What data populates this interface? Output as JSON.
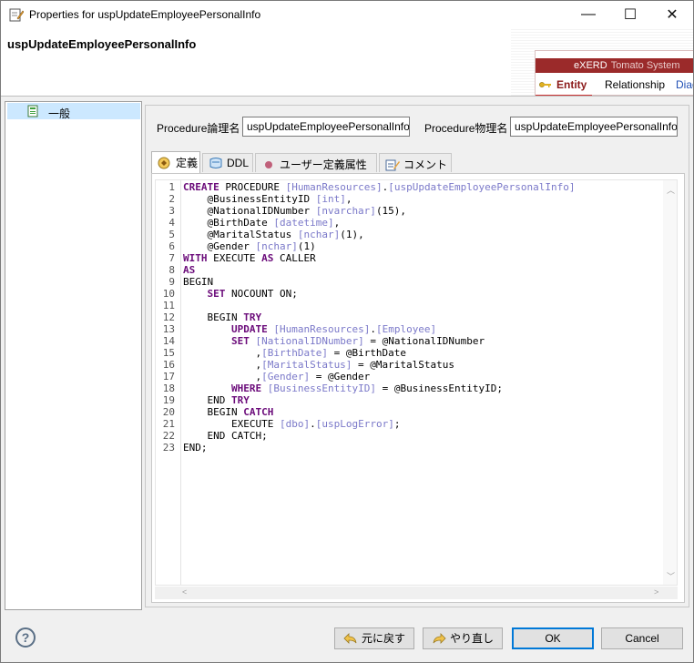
{
  "window": {
    "title": "Properties for uspUpdateEmployeePersonalInfo",
    "minimize": "—",
    "maximize": "☐",
    "close": "✕"
  },
  "banner": {
    "title": "uspUpdateEmployeePersonalInfo",
    "brand": "eXERD",
    "brand_sub": "Tomato System",
    "tabs": [
      "Entity",
      "Relationship",
      "Diag"
    ]
  },
  "tree": {
    "items": [
      {
        "label": "一般",
        "selected": true
      }
    ]
  },
  "form": {
    "logical_label": "Procedure論理名",
    "logical_value": "uspUpdateEmployeePersonalInfo",
    "physical_label": "Procedure物理名",
    "physical_value": "uspUpdateEmployeePersonalInfo"
  },
  "tabs": [
    {
      "label": "定義",
      "active": true
    },
    {
      "label": "DDL",
      "active": false
    },
    {
      "label": "ユーザー定義属性",
      "active": false
    },
    {
      "label": "コメント",
      "active": false
    }
  ],
  "editor": {
    "line_numbers": [
      "1",
      "2",
      "3",
      "4",
      "5",
      "6",
      "7",
      "8",
      "9",
      "10",
      "11",
      "12",
      "13",
      "14",
      "15",
      "16",
      "17",
      "18",
      "19",
      "20",
      "21",
      "22",
      "23"
    ],
    "lines": [
      [
        [
          "kw",
          "CREATE"
        ],
        [
          "pl",
          " PROCEDURE "
        ],
        [
          "br",
          "[HumanResources]"
        ],
        [
          "pl",
          "."
        ],
        [
          "br",
          "[uspUpdateEmployeePersonalInfo]"
        ]
      ],
      [
        [
          "pl",
          "    @BusinessEntityID "
        ],
        [
          "br",
          "[int]"
        ],
        [
          "pl",
          ","
        ]
      ],
      [
        [
          "pl",
          "    @NationalIDNumber "
        ],
        [
          "br",
          "[nvarchar]"
        ],
        [
          "pl",
          "(15),"
        ]
      ],
      [
        [
          "pl",
          "    @BirthDate "
        ],
        [
          "br",
          "[datetime]"
        ],
        [
          "pl",
          ","
        ]
      ],
      [
        [
          "pl",
          "    @MaritalStatus "
        ],
        [
          "br",
          "[nchar]"
        ],
        [
          "pl",
          "(1),"
        ]
      ],
      [
        [
          "pl",
          "    @Gender "
        ],
        [
          "br",
          "[nchar]"
        ],
        [
          "pl",
          "(1)"
        ]
      ],
      [
        [
          "kw",
          "WITH"
        ],
        [
          "pl",
          " EXECUTE "
        ],
        [
          "kw",
          "AS"
        ],
        [
          "pl",
          " CALLER"
        ]
      ],
      [
        [
          "kw",
          "AS"
        ]
      ],
      [
        [
          "pl",
          "BEGIN"
        ]
      ],
      [
        [
          "pl",
          "    "
        ],
        [
          "kw",
          "SET"
        ],
        [
          "pl",
          " NOCOUNT ON;"
        ]
      ],
      [
        [
          "pl",
          ""
        ]
      ],
      [
        [
          "pl",
          "    BEGIN "
        ],
        [
          "kw",
          "TRY"
        ]
      ],
      [
        [
          "pl",
          "        "
        ],
        [
          "kw",
          "UPDATE"
        ],
        [
          "pl",
          " "
        ],
        [
          "br",
          "[HumanResources]"
        ],
        [
          "pl",
          "."
        ],
        [
          "br",
          "[Employee]"
        ]
      ],
      [
        [
          "pl",
          "        "
        ],
        [
          "kw",
          "SET"
        ],
        [
          "pl",
          " "
        ],
        [
          "br",
          "[NationalIDNumber]"
        ],
        [
          "pl",
          " = @NationalIDNumber"
        ]
      ],
      [
        [
          "pl",
          "            ,"
        ],
        [
          "br",
          "[BirthDate]"
        ],
        [
          "pl",
          " = @BirthDate"
        ]
      ],
      [
        [
          "pl",
          "            ,"
        ],
        [
          "br",
          "[MaritalStatus]"
        ],
        [
          "pl",
          " = @MaritalStatus"
        ]
      ],
      [
        [
          "pl",
          "            ,"
        ],
        [
          "br",
          "[Gender]"
        ],
        [
          "pl",
          " = @Gender"
        ]
      ],
      [
        [
          "pl",
          "        "
        ],
        [
          "kw",
          "WHERE"
        ],
        [
          "pl",
          " "
        ],
        [
          "br",
          "[BusinessEntityID]"
        ],
        [
          "pl",
          " = @BusinessEntityID;"
        ]
      ],
      [
        [
          "pl",
          "    END "
        ],
        [
          "kw",
          "TRY"
        ]
      ],
      [
        [
          "pl",
          "    BEGIN "
        ],
        [
          "kw",
          "CATCH"
        ]
      ],
      [
        [
          "pl",
          "        EXECUTE "
        ],
        [
          "br",
          "[dbo]"
        ],
        [
          "pl",
          "."
        ],
        [
          "br",
          "[uspLogError]"
        ],
        [
          "pl",
          ";"
        ]
      ],
      [
        [
          "pl",
          "    END CATCH;"
        ]
      ],
      [
        [
          "pl",
          "END;"
        ]
      ]
    ]
  },
  "buttons": {
    "help": "?",
    "back": "元に戻す",
    "forward": "やり直し",
    "ok": "OK",
    "cancel": "Cancel"
  },
  "colors": {
    "keyword": "#6b0b7a",
    "bracket": "#7b79c9",
    "brand_red": "#9b2a2a",
    "selection": "#cce8ff",
    "ok_border": "#0078d7"
  }
}
